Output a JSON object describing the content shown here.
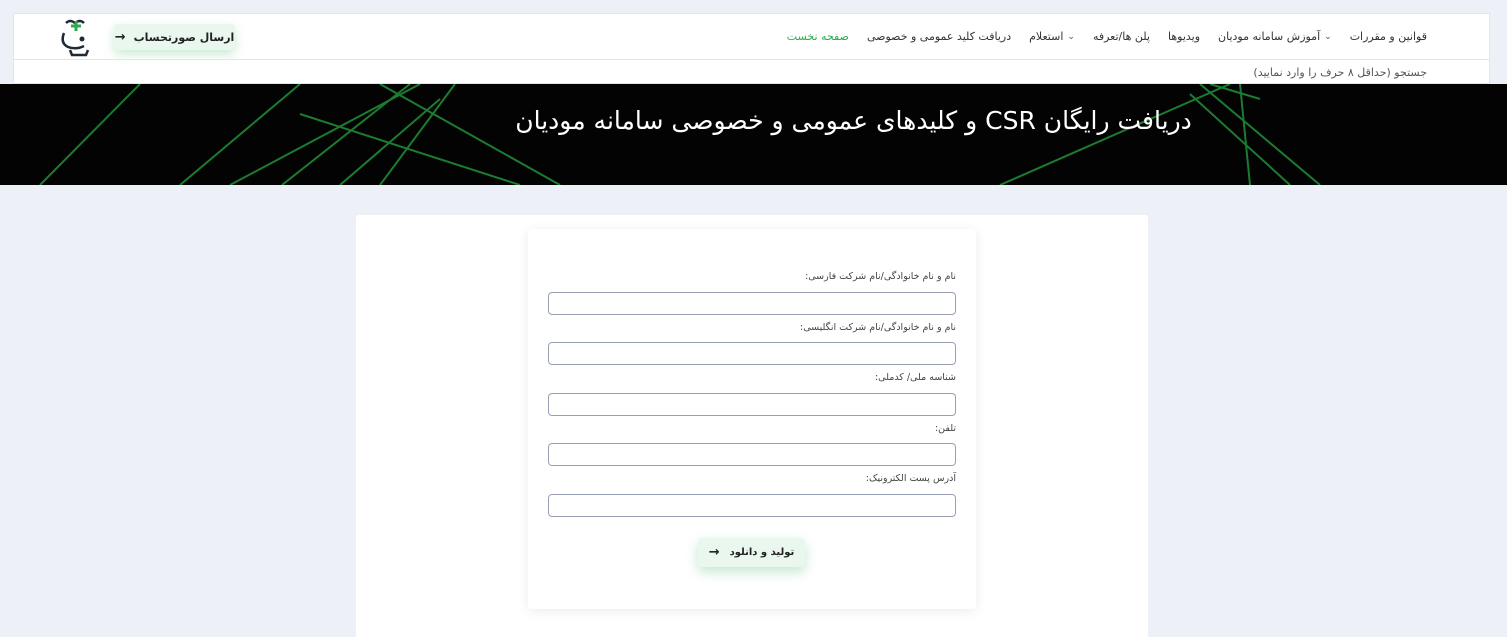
{
  "nav": {
    "items": [
      {
        "label": "قوانین و مقررات"
      },
      {
        "label": "آموزش سامانه مودیان"
      },
      {
        "label": "ویدیوها"
      },
      {
        "label": "پلن ها/تعرفه"
      },
      {
        "label": "استعلام"
      },
      {
        "label": "دریافت کلید عمومی و خصوصی"
      },
      {
        "label": "صفحه نخست"
      }
    ],
    "send_invoice_label": "ارسال صورتحساب",
    "search_placeholder": "جستجو (حداقل ۸ حرف را وارد نمایید)"
  },
  "banner": {
    "title": "دریافت رایگان CSR و کلیدهای عمومی و خصوصی سامانه مودیان"
  },
  "form": {
    "fields": [
      {
        "label": "نام و نام خانوادگی/نام شرکت فارسی:",
        "value": ""
      },
      {
        "label": "نام و نام خانوادگی/نام شرکت انگلیسی:",
        "value": ""
      },
      {
        "label": "شناسه ملی/ کدملی:",
        "value": ""
      },
      {
        "label": "تلفن:",
        "value": ""
      },
      {
        "label": "آدرس پست الکترونیک:",
        "value": ""
      }
    ],
    "submit_label": "تولید و دانلود"
  },
  "colors": {
    "accent": "#2cab4c",
    "banner_bg": "#030303",
    "page_bg": "#eef0f8"
  },
  "icons": {
    "send_button": "arrow-right-icon",
    "submit_button": "arrow-right-icon",
    "dropdown": "chevron-down-icon",
    "logo": "logo-icon"
  }
}
